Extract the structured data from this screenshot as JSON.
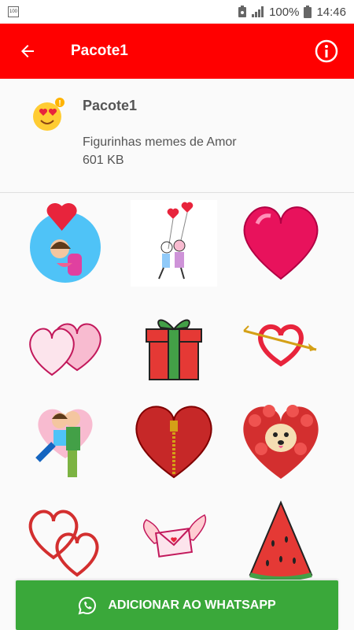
{
  "status": {
    "battery": "100%",
    "time": "14:46",
    "left_icon_text": "100"
  },
  "toolbar": {
    "title": "Pacote1",
    "back_icon": "arrow-left-icon",
    "info_icon": "info-icon"
  },
  "pack": {
    "name": "Pacote1",
    "description": "Figurinhas memes de Amor",
    "size": "601 KB",
    "icon": "heart-eyes-emoji-icon"
  },
  "stickers": [
    {
      "name": "couple-balloon-heart-sticker"
    },
    {
      "name": "stick-couple-balloons-sticker"
    },
    {
      "name": "pink-heart-sticker"
    },
    {
      "name": "double-glass-hearts-sticker"
    },
    {
      "name": "gift-box-sticker"
    },
    {
      "name": "arrow-heart-sticker"
    },
    {
      "name": "hugging-couple-sticker"
    },
    {
      "name": "zipper-heart-sticker"
    },
    {
      "name": "dog-rose-heart-sticker"
    },
    {
      "name": "outline-hearts-sticker"
    },
    {
      "name": "winged-letter-sticker"
    },
    {
      "name": "watermelon-slice-sticker"
    }
  ],
  "action": {
    "label": "ADICIONAR AO WHATSAPP",
    "icon": "whatsapp-icon"
  },
  "colors": {
    "toolbar": "#ff0000",
    "button": "#3aa83a"
  }
}
